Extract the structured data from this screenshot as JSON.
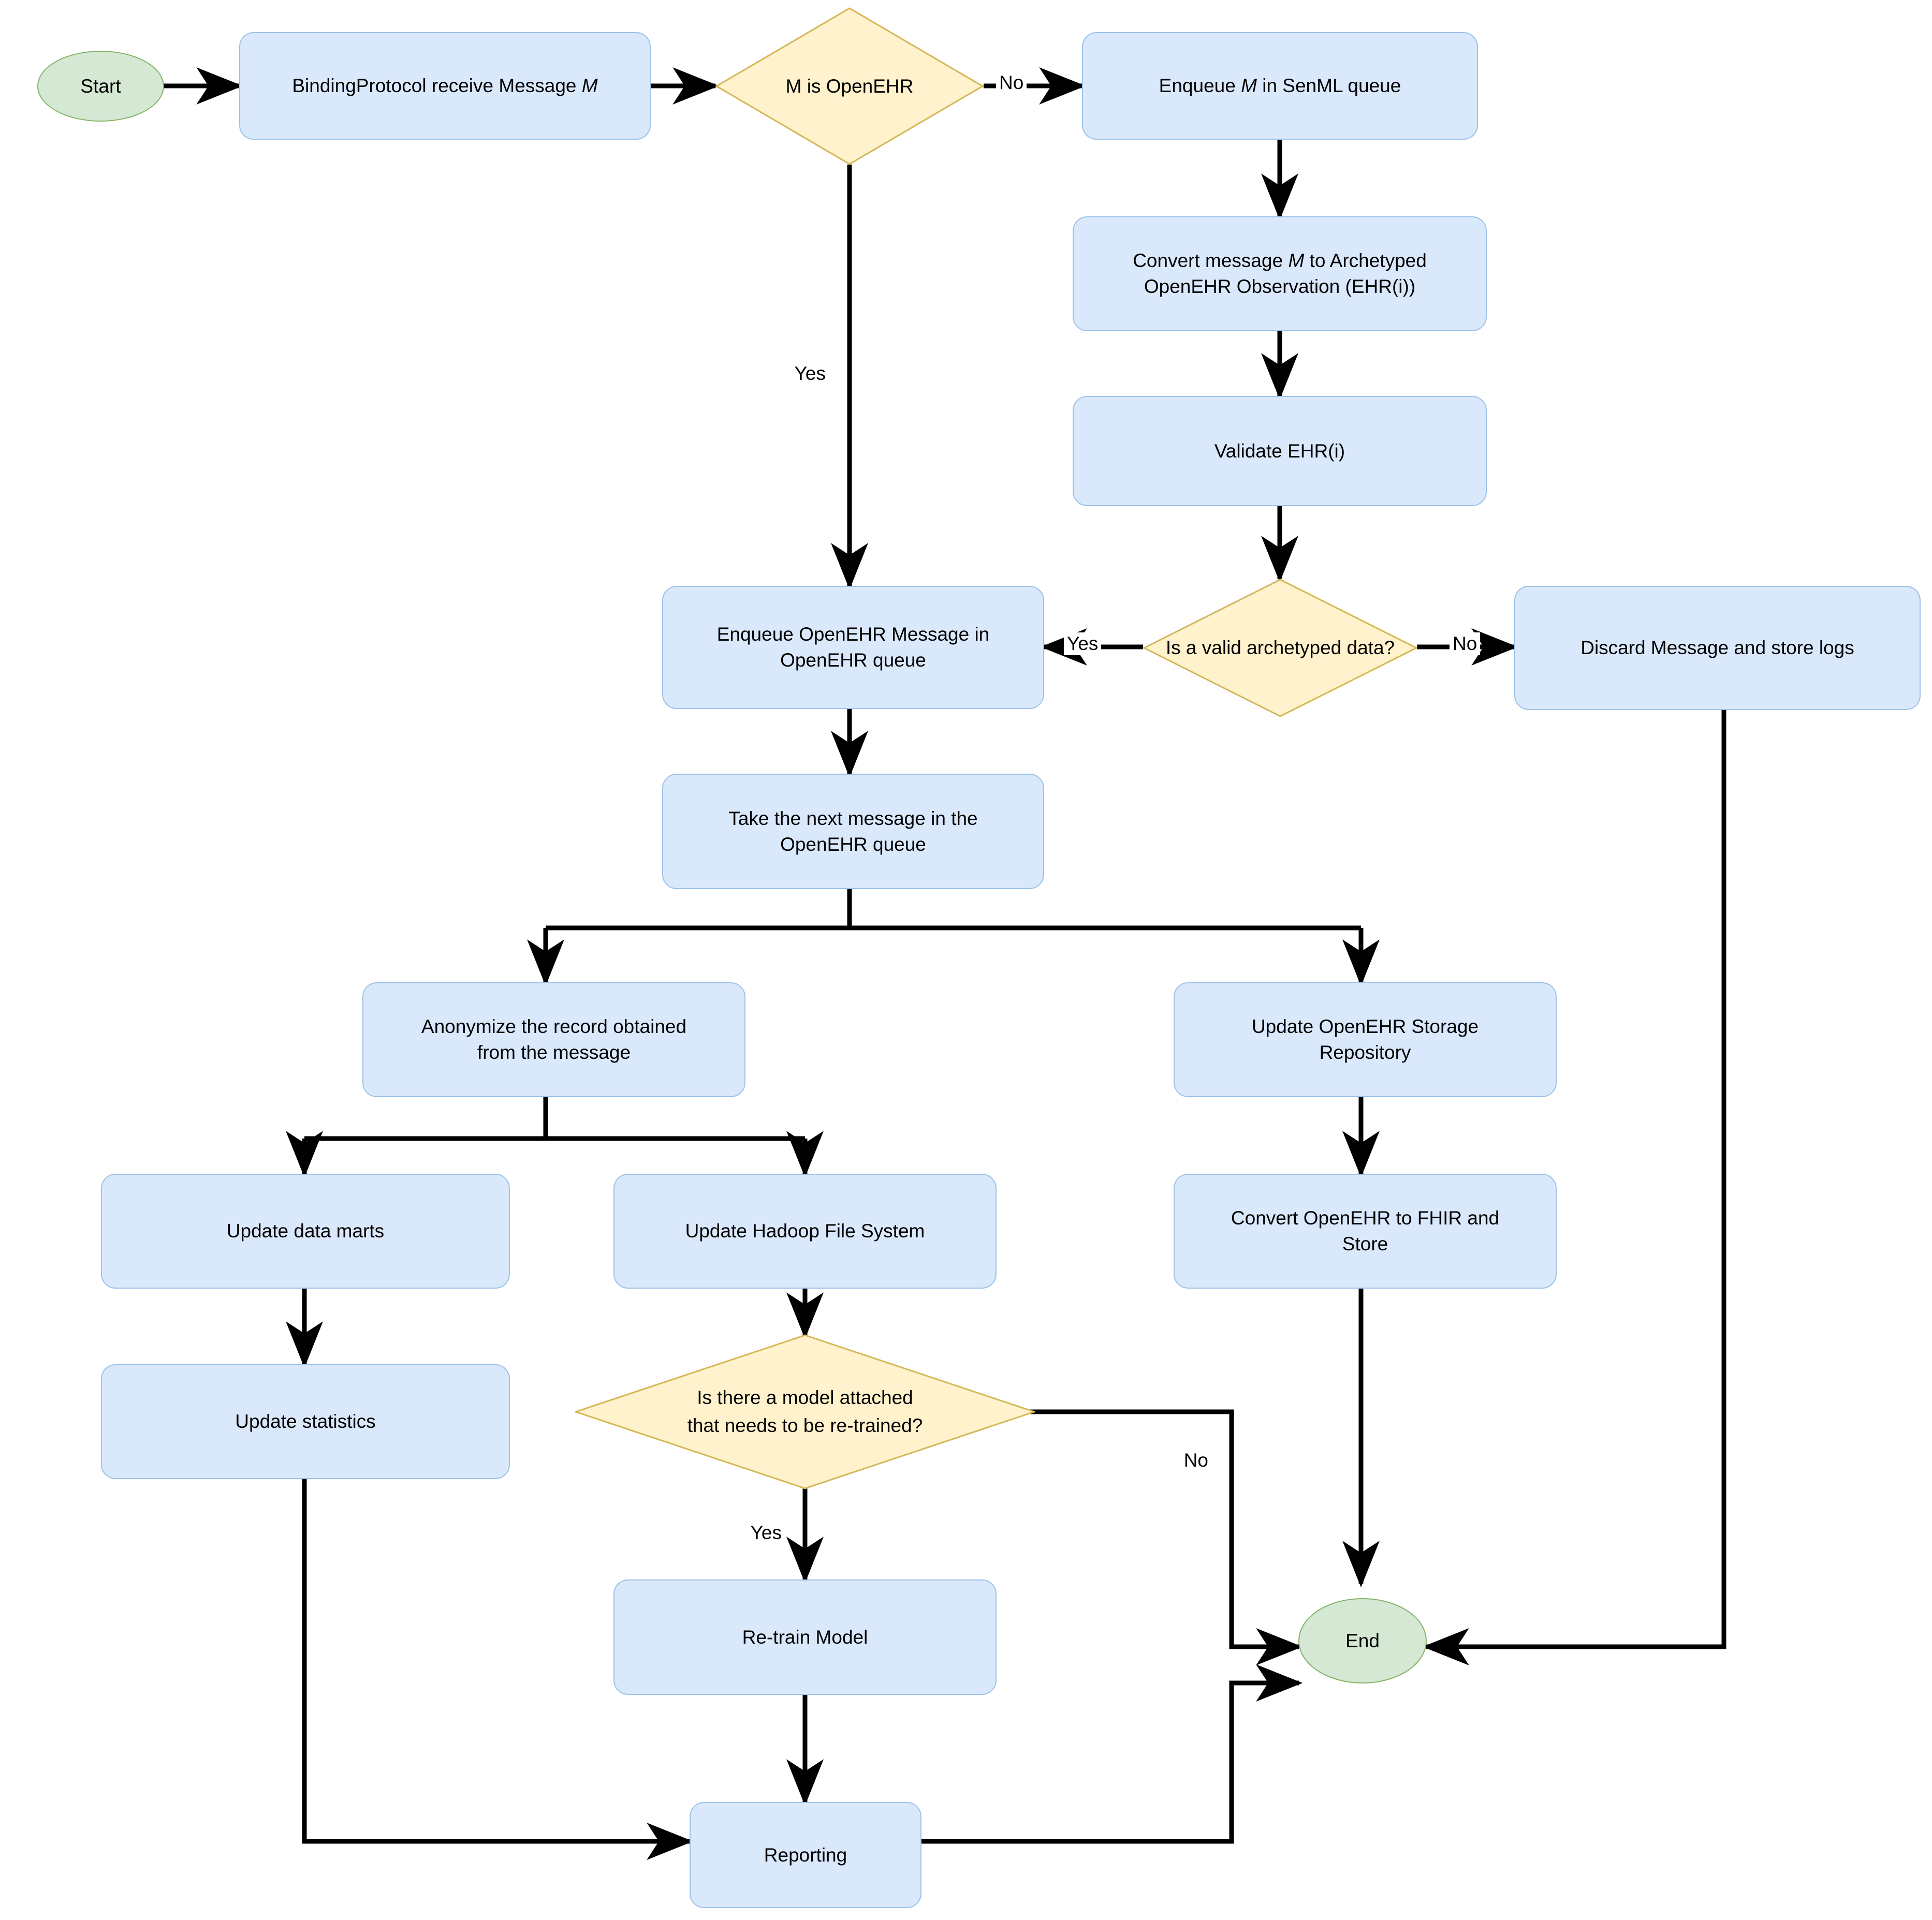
{
  "diagram": {
    "title_visible": false,
    "colors": {
      "process_fill": "#dae8fc",
      "process_stroke": "#9cc2e8",
      "decision_fill": "#fff2cc",
      "decision_stroke": "#d6b656",
      "terminator_fill": "#d5e8d4",
      "terminator_stroke": "#82b366",
      "edge_stroke": "#000000",
      "background": "#ffffff"
    },
    "nodes": {
      "start": {
        "label": "Start",
        "shape": "ellipse",
        "kind": "terminator"
      },
      "receive": {
        "label": "BindingProtocol receive Message ",
        "label_italic": "M",
        "shape": "rounded-rect",
        "kind": "process"
      },
      "is_openehr": {
        "label": "M is OpenEHR",
        "shape": "diamond",
        "kind": "decision"
      },
      "enqueue_senml": {
        "label_pre": "Enqueue ",
        "label_italic": "M",
        "label_post": " in SenML queue",
        "shape": "rounded-rect",
        "kind": "process"
      },
      "convert_archetyped": {
        "line1_pre": "Convert message ",
        "line1_italic": "M",
        "line1_post": " to Archetyped",
        "line2": "OpenEHR Observation (EHR(i))",
        "shape": "rounded-rect",
        "kind": "process"
      },
      "validate": {
        "label": "Validate EHR(i)",
        "shape": "rounded-rect",
        "kind": "process"
      },
      "is_valid_archetyped": {
        "label": "Is a valid archetyped data?",
        "shape": "diamond",
        "kind": "decision"
      },
      "enqueue_openehr": {
        "line1": "Enqueue OpenEHR Message in",
        "line2": "OpenEHR queue",
        "shape": "rounded-rect",
        "kind": "process"
      },
      "discard": {
        "label": "Discard Message and store logs",
        "shape": "rounded-rect",
        "kind": "process"
      },
      "take_next": {
        "line1": "Take the next message in the",
        "line2": "OpenEHR queue",
        "shape": "rounded-rect",
        "kind": "process"
      },
      "anonymize": {
        "line1": "Anonymize the record obtained",
        "line2": "from the message",
        "shape": "rounded-rect",
        "kind": "process"
      },
      "update_storage": {
        "line1": "Update OpenEHR Storage",
        "line2": "Repository",
        "shape": "rounded-rect",
        "kind": "process"
      },
      "update_data_marts": {
        "label": "Update data marts",
        "shape": "rounded-rect",
        "kind": "process"
      },
      "update_hadoop": {
        "label": "Update Hadoop File System",
        "shape": "rounded-rect",
        "kind": "process"
      },
      "convert_fhir": {
        "line1": "Convert OpenEHR to FHIR and",
        "line2": "Store",
        "shape": "rounded-rect",
        "kind": "process"
      },
      "update_statistics": {
        "label": "Update statistics",
        "shape": "rounded-rect",
        "kind": "process"
      },
      "model_retrain": {
        "line1": "Is there a model attached",
        "line2": "that needs to be re-trained?",
        "shape": "diamond",
        "kind": "decision"
      },
      "retrain_model": {
        "label": "Re-train Model",
        "shape": "rounded-rect",
        "kind": "process"
      },
      "reporting": {
        "label": "Reporting",
        "shape": "rounded-rect",
        "kind": "process"
      },
      "end": {
        "label": "End",
        "shape": "ellipse",
        "kind": "terminator"
      }
    },
    "edge_labels": {
      "openehr_no": "No",
      "openehr_yes": "Yes",
      "valid_yes": "Yes",
      "valid_no": "No",
      "retrain_yes": "Yes",
      "retrain_no": "No"
    },
    "edges": [
      {
        "from": "start",
        "to": "receive",
        "label": ""
      },
      {
        "from": "receive",
        "to": "is_openehr",
        "label": ""
      },
      {
        "from": "is_openehr",
        "to": "enqueue_senml",
        "label": "No"
      },
      {
        "from": "is_openehr",
        "to": "enqueue_openehr",
        "label": "Yes"
      },
      {
        "from": "enqueue_senml",
        "to": "convert_archetyped",
        "label": ""
      },
      {
        "from": "convert_archetyped",
        "to": "validate",
        "label": ""
      },
      {
        "from": "validate",
        "to": "is_valid_archetyped",
        "label": ""
      },
      {
        "from": "is_valid_archetyped",
        "to": "enqueue_openehr",
        "label": "Yes"
      },
      {
        "from": "is_valid_archetyped",
        "to": "discard",
        "label": "No"
      },
      {
        "from": "enqueue_openehr",
        "to": "take_next",
        "label": ""
      },
      {
        "from": "take_next",
        "to": "anonymize",
        "label": ""
      },
      {
        "from": "take_next",
        "to": "update_storage",
        "label": ""
      },
      {
        "from": "anonymize",
        "to": "update_data_marts",
        "label": ""
      },
      {
        "from": "anonymize",
        "to": "update_hadoop",
        "label": ""
      },
      {
        "from": "update_storage",
        "to": "convert_fhir",
        "label": ""
      },
      {
        "from": "update_data_marts",
        "to": "update_statistics",
        "label": ""
      },
      {
        "from": "update_hadoop",
        "to": "model_retrain",
        "label": ""
      },
      {
        "from": "model_retrain",
        "to": "retrain_model",
        "label": "Yes"
      },
      {
        "from": "model_retrain",
        "to": "end",
        "label": "No"
      },
      {
        "from": "retrain_model",
        "to": "reporting",
        "label": ""
      },
      {
        "from": "update_statistics",
        "to": "reporting",
        "label": ""
      },
      {
        "from": "convert_fhir",
        "to": "end",
        "label": ""
      },
      {
        "from": "reporting",
        "to": "end",
        "label": ""
      },
      {
        "from": "discard",
        "to": "end",
        "label": ""
      }
    ]
  }
}
